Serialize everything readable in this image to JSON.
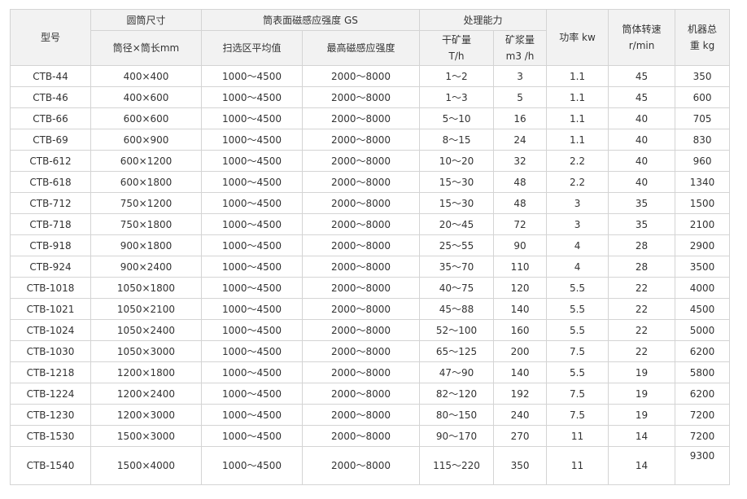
{
  "headers": {
    "model": "型号",
    "drum_size": "圆筒尺寸",
    "drum_size_sub": "筒径×筒长mm",
    "field_strength": "筒表面磁感应强度 GS",
    "field_avg": "扫选区平均值",
    "field_max": "最高磁感应强度",
    "capacity": "处理能力",
    "dry_ore_line1": "干矿量",
    "dry_ore_line2": "T/h",
    "slurry_line1": "矿浆量",
    "slurry_line2": "m3 /h",
    "power": "功率 kw",
    "speed_line1": "筒体转速",
    "speed_line2": "r/min",
    "weight_line1": "机器总",
    "weight_line2": "重 kg"
  },
  "rows": [
    {
      "model": "CTB-44",
      "size": "400×400",
      "avg": "1000～4500",
      "max": "2000～8000",
      "dry": "1～2",
      "slurry": "3",
      "power": "1.1",
      "speed": "45",
      "weight": "350"
    },
    {
      "model": "CTB-46",
      "size": "400×600",
      "avg": "1000～4500",
      "max": "2000～8000",
      "dry": "1～3",
      "slurry": "5",
      "power": "1.1",
      "speed": "45",
      "weight": "600"
    },
    {
      "model": "CTB-66",
      "size": "600×600",
      "avg": "1000～4500",
      "max": "2000～8000",
      "dry": "5～10",
      "slurry": "16",
      "power": "1.1",
      "speed": "40",
      "weight": "705"
    },
    {
      "model": "CTB-69",
      "size": "600×900",
      "avg": "1000～4500",
      "max": "2000～8000",
      "dry": "8～15",
      "slurry": "24",
      "power": "1.1",
      "speed": "40",
      "weight": "830"
    },
    {
      "model": "CTB-612",
      "size": "600×1200",
      "avg": "1000～4500",
      "max": "2000～8000",
      "dry": "10～20",
      "slurry": "32",
      "power": "2.2",
      "speed": "40",
      "weight": "960"
    },
    {
      "model": "CTB-618",
      "size": "600×1800",
      "avg": "1000～4500",
      "max": "2000～8000",
      "dry": "15～30",
      "slurry": "48",
      "power": "2.2",
      "speed": "40",
      "weight": "1340"
    },
    {
      "model": "CTB-712",
      "size": "750×1200",
      "avg": "1000～4500",
      "max": "2000～8000",
      "dry": "15～30",
      "slurry": "48",
      "power": "3",
      "speed": "35",
      "weight": "1500"
    },
    {
      "model": "CTB-718",
      "size": "750×1800",
      "avg": "1000～4500",
      "max": "2000～8000",
      "dry": "20～45",
      "slurry": "72",
      "power": "3",
      "speed": "35",
      "weight": "2100"
    },
    {
      "model": "CTB-918",
      "size": "900×1800",
      "avg": "1000～4500",
      "max": "2000～8000",
      "dry": "25～55",
      "slurry": "90",
      "power": "4",
      "speed": "28",
      "weight": "2900"
    },
    {
      "model": "CTB-924",
      "size": "900×2400",
      "avg": "1000～4500",
      "max": "2000～8000",
      "dry": "35～70",
      "slurry": "110",
      "power": "4",
      "speed": "28",
      "weight": "3500"
    },
    {
      "model": "CTB-1018",
      "size": "1050×1800",
      "avg": "1000～4500",
      "max": "2000～8000",
      "dry": "40～75",
      "slurry": "120",
      "power": "5.5",
      "speed": "22",
      "weight": "4000"
    },
    {
      "model": "CTB-1021",
      "size": "1050×2100",
      "avg": "1000～4500",
      "max": "2000～8000",
      "dry": "45～88",
      "slurry": "140",
      "power": "5.5",
      "speed": "22",
      "weight": "4500"
    },
    {
      "model": "CTB-1024",
      "size": "1050×2400",
      "avg": "1000～4500",
      "max": "2000～8000",
      "dry": "52～100",
      "slurry": "160",
      "power": "5.5",
      "speed": "22",
      "weight": "5000"
    },
    {
      "model": "CTB-1030",
      "size": "1050×3000",
      "avg": "1000～4500",
      "max": "2000～8000",
      "dry": "65～125",
      "slurry": "200",
      "power": "7.5",
      "speed": "22",
      "weight": "6200"
    },
    {
      "model": "CTB-1218",
      "size": "1200×1800",
      "avg": "1000～4500",
      "max": "2000～8000",
      "dry": "47～90",
      "slurry": "140",
      "power": "5.5",
      "speed": "19",
      "weight": "5800"
    },
    {
      "model": "CTB-1224",
      "size": "1200×2400",
      "avg": "1000～4500",
      "max": "2000～8000",
      "dry": "82～120",
      "slurry": "192",
      "power": "7.5",
      "speed": "19",
      "weight": "6200"
    },
    {
      "model": "CTB-1230",
      "size": "1200×3000",
      "avg": "1000～4500",
      "max": "2000～8000",
      "dry": "80～150",
      "slurry": "240",
      "power": "7.5",
      "speed": "19",
      "weight": "7200"
    },
    {
      "model": "CTB-1530",
      "size": "1500×3000",
      "avg": "1000～4500",
      "max": "2000～8000",
      "dry": "90～170",
      "slurry": "270",
      "power": "11",
      "speed": "14",
      "weight": "7200"
    },
    {
      "model": "CTB-1540",
      "size": "1500×4000",
      "avg": "1000～4500",
      "max": "2000～8000",
      "dry": "115～220",
      "slurry": "350",
      "power": "11",
      "speed": "14",
      "weight": "9300"
    }
  ]
}
